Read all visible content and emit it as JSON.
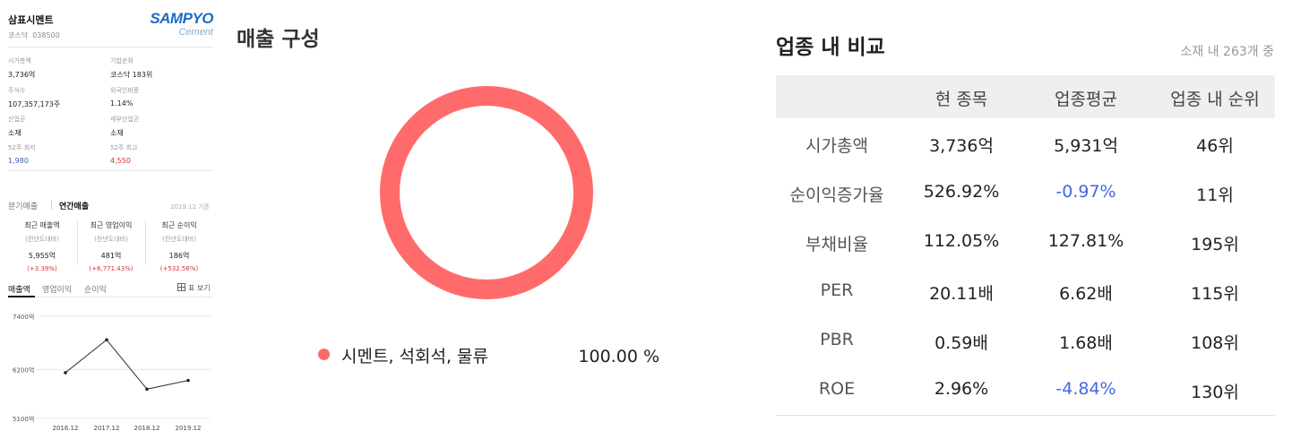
{
  "company": {
    "name": "삼표시멘트",
    "market": "코스닥",
    "code": "038500",
    "logo_text": "SAMPYO",
    "logo_sub": "Cement"
  },
  "info": [
    {
      "label": "시가총액",
      "value": "3,736억",
      "tone": ""
    },
    {
      "label": "기업순위",
      "value": "코스닥 183위",
      "tone": ""
    },
    {
      "label": "주식수",
      "value": "107,357,173주",
      "tone": ""
    },
    {
      "label": "외국인비중",
      "value": "1.14%",
      "tone": ""
    },
    {
      "label": "산업군",
      "value": "소재",
      "tone": ""
    },
    {
      "label": "세부산업군",
      "value": "소재",
      "tone": ""
    },
    {
      "label": "52주 최저",
      "value": "1,980",
      "tone": "blue"
    },
    {
      "label": "52주 최고",
      "value": "4,550",
      "tone": "red"
    }
  ],
  "sales_tabs": {
    "quarterly": "분기매출",
    "annual": "연간매출",
    "as_of": "2019.12 기준"
  },
  "stats": [
    {
      "title": "최근 매출액",
      "sub": "(전년도대비)",
      "value": "5,955억",
      "change": "(+3.39%)"
    },
    {
      "title": "최근 영업이익",
      "sub": "(전년도대비)",
      "value": "481억",
      "change": "(+6,771.43%)"
    },
    {
      "title": "최근 순이익",
      "sub": "(전년도대비)",
      "value": "186억",
      "change": "(+532.56%)"
    }
  ],
  "chart_tabs": [
    "매출액",
    "영업이익",
    "순이익"
  ],
  "table_view": "표 보기",
  "chart_data": [
    {
      "type": "line",
      "x": [
        "2016.12",
        "2017.12",
        "2018.12",
        "2019.12"
      ],
      "series": [
        {
          "values": [
            6130,
            6870,
            5760,
            5955
          ]
        }
      ],
      "yticks": [
        "7400억",
        "6200억",
        "5100억"
      ],
      "ytick_values": [
        7400,
        6200,
        5100
      ],
      "ylim": [
        5100,
        7400
      ],
      "grid": true
    },
    {
      "type": "pie",
      "title": "매출 구성",
      "labels": [
        "시멘트, 석회석, 물류"
      ],
      "values": [
        100.0
      ],
      "value_label": "100.00 %",
      "colors": [
        "#ff6b6b"
      ]
    }
  ],
  "middle": {
    "title": "매출 구성",
    "legend_label": "시멘트, 석회석, 물류",
    "legend_value": "100.00 %"
  },
  "compare": {
    "title": "업종 내 비교",
    "note": "소재 내 263개 중",
    "headers": [
      "현 종목",
      "업종평균",
      "업종 내 순위"
    ],
    "rows": [
      {
        "label": "시가총액",
        "cur": "3,736억",
        "avg": "5,931억",
        "rank": "46위",
        "avg_neg": false
      },
      {
        "label": "순이익증가율",
        "cur": "526.92%",
        "avg": "-0.97%",
        "rank": "11위",
        "avg_neg": true
      },
      {
        "label": "부채비율",
        "cur": "112.05%",
        "avg": "127.81%",
        "rank": "195위",
        "avg_neg": false
      },
      {
        "label": "PER",
        "cur": "20.11배",
        "avg": "6.62배",
        "rank": "115위",
        "avg_neg": false
      },
      {
        "label": "PBR",
        "cur": "0.59배",
        "avg": "1.68배",
        "rank": "108위",
        "avg_neg": false
      },
      {
        "label": "ROE",
        "cur": "2.96%",
        "avg": "-4.84%",
        "rank": "130위",
        "avg_neg": true
      }
    ]
  },
  "colors": {
    "accent": "#ff6b6b",
    "negative": "#4169e1",
    "up": "#d2312d",
    "down": "#3b5fc0",
    "logo": "#1a6cc8"
  }
}
